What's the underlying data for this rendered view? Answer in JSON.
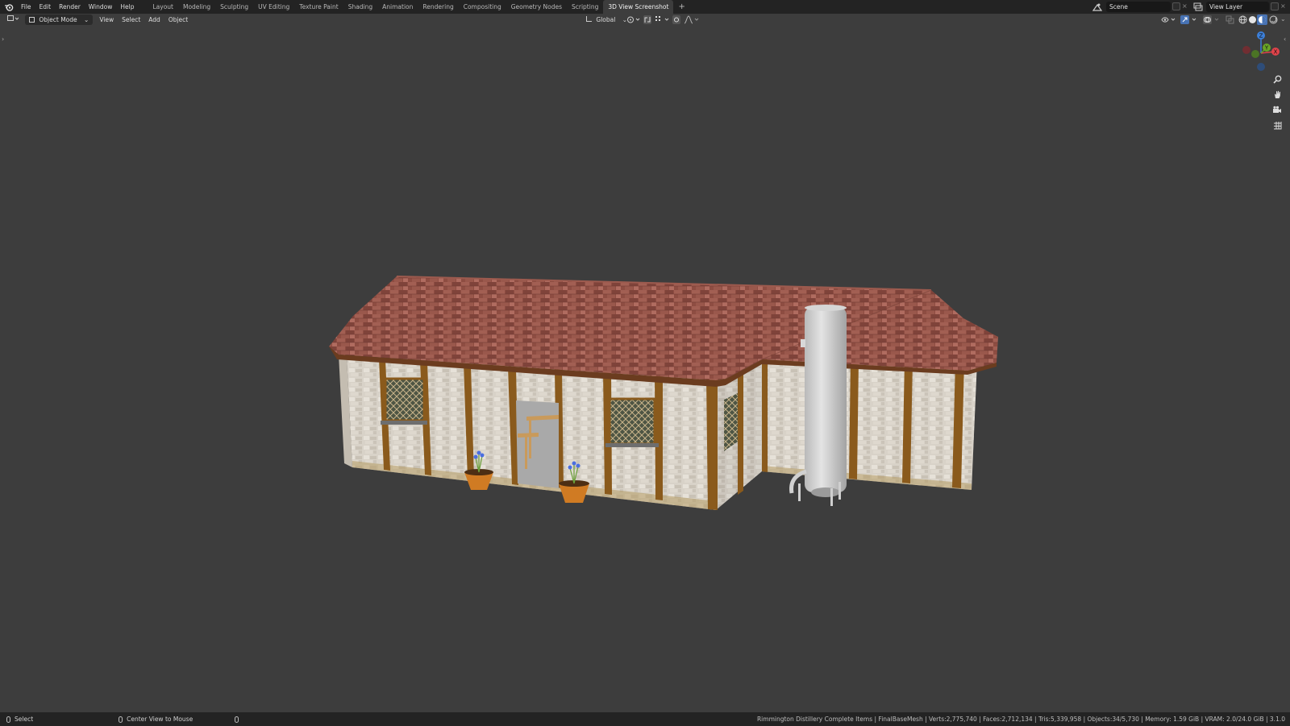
{
  "topbar": {
    "menus": [
      "File",
      "Edit",
      "Render",
      "Window",
      "Help"
    ],
    "workspace_tabs": [
      "Layout",
      "Modeling",
      "Sculpting",
      "UV Editing",
      "Texture Paint",
      "Shading",
      "Animation",
      "Rendering",
      "Compositing",
      "Geometry Nodes",
      "Scripting",
      "3D View Screenshot"
    ],
    "active_tab": "3D View Screenshot",
    "add_tab": "+",
    "scene": "Scene",
    "view_layer": "View Layer"
  },
  "viewport_header": {
    "mode": "Object Mode",
    "menus": [
      "View",
      "Select",
      "Add",
      "Object"
    ],
    "transform_orientation": "Global"
  },
  "gizmo": {
    "z": "Z",
    "y": "Y",
    "x": "X"
  },
  "statusbar": {
    "select": "Select",
    "center_view": "Center View to Mouse",
    "stats": "Rimmington Distillery Complete Items | FinalBaseMesh | Verts:2,775,740 | Faces:2,712,134 | Tris:5,339,958 | Objects:34/5,730 | Memory: 1.59 GiB | VRAM: 2.0/24.0 GiB | 3.1.0"
  },
  "colors": {
    "viewport": "#3d3d3d",
    "roof": "#8f4f44",
    "wall": "#d6d0c6",
    "timber": "#8a5a1c",
    "axis_x": "#e0434a",
    "axis_y": "#6aa525",
    "axis_z": "#3c7fd8"
  }
}
